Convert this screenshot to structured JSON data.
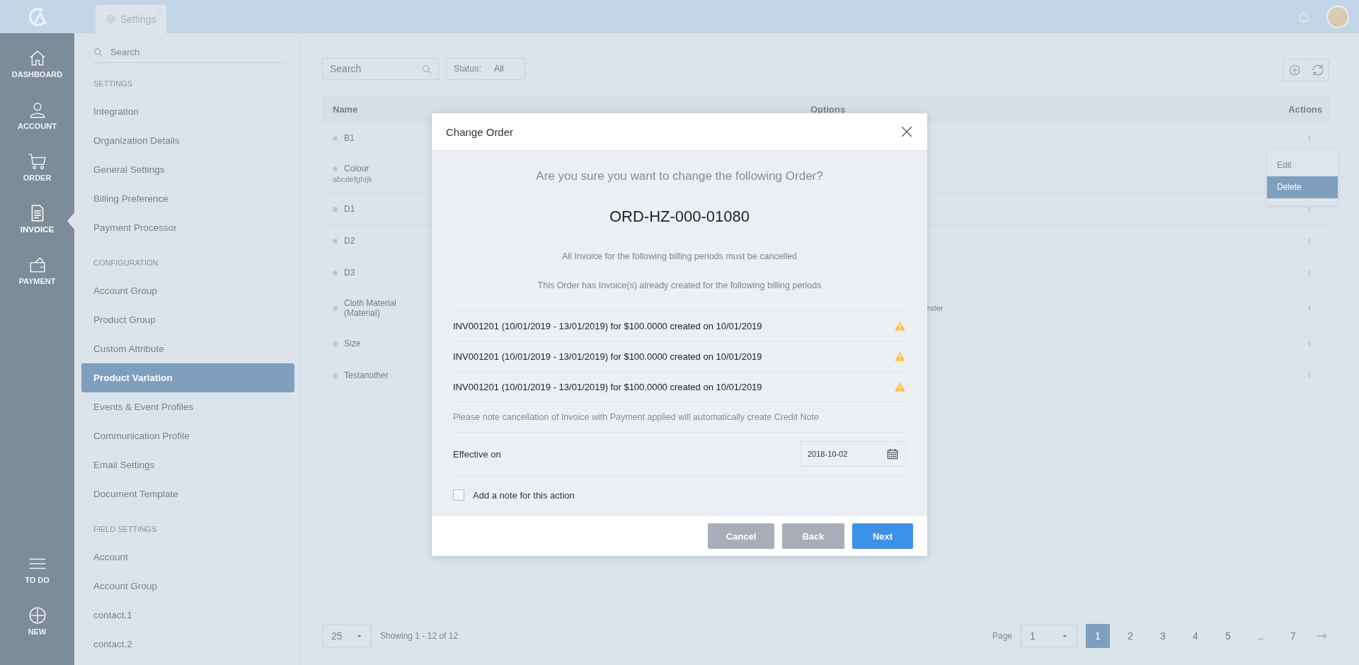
{
  "top_bar": {
    "tab": {
      "label": "Settings"
    }
  },
  "rail": {
    "items": [
      {
        "label": "DASHBOARD",
        "kind": "home",
        "selected": false
      },
      {
        "label": "ACCOUNT",
        "kind": "person",
        "selected": false
      },
      {
        "label": "ORDER",
        "kind": "cart",
        "selected": false
      },
      {
        "label": "INVOICE",
        "kind": "document",
        "selected": true
      },
      {
        "label": "PAYMENT",
        "kind": "wallet",
        "selected": false
      }
    ],
    "bottom_items": [
      {
        "label": "TO DO",
        "kind": "lines"
      },
      {
        "label": "NEW",
        "kind": "plus"
      }
    ]
  },
  "settings_nav": {
    "search": {
      "placeholder": "Search"
    },
    "sections": [
      {
        "heading": "SETTINGS",
        "items": [
          {
            "label": "Integration",
            "selected": false
          },
          {
            "label": "Organization Details",
            "selected": false
          },
          {
            "label": "General Settings",
            "selected": false
          },
          {
            "label": "Billing Preference",
            "selected": false
          },
          {
            "label": "Payment Processor",
            "selected": false
          }
        ]
      },
      {
        "heading": "CONFIGURATION",
        "items": [
          {
            "label": "Account Group",
            "selected": false
          },
          {
            "label": "Product Group",
            "selected": false
          },
          {
            "label": "Custom Attribute",
            "selected": false
          },
          {
            "label": "Product Variation",
            "selected": true
          },
          {
            "label": "Events & Event Profiles",
            "selected": false
          },
          {
            "label": "Communication Profile",
            "selected": false
          },
          {
            "label": "Email Settings",
            "selected": false
          },
          {
            "label": "Document Template",
            "selected": false
          }
        ]
      },
      {
        "heading": "FIELD SETTINGS",
        "items": [
          {
            "label": "Account",
            "selected": false
          },
          {
            "label": "Account Group",
            "selected": false
          },
          {
            "label": "contact.1",
            "selected": false
          },
          {
            "label": "contact.2",
            "selected": false
          }
        ]
      }
    ]
  },
  "toolbar": {
    "search": {
      "placeholder": "Search"
    },
    "status_filter": {
      "label": "Status:",
      "value": "All"
    }
  },
  "table": {
    "columns": [
      "Name",
      "Options",
      "Actions"
    ],
    "rows": [
      {
        "name": "B1",
        "actions": true
      },
      {
        "name": "Colour",
        "subtitle": "abcdefghijk",
        "actions": false
      },
      {
        "name": "D1",
        "actions": true
      },
      {
        "name": "D2",
        "actions": true
      },
      {
        "name": "D3",
        "actions": true
      },
      {
        "name": "Cloth Material (Material)",
        "options": "ester",
        "actions": true
      },
      {
        "name": "Size",
        "actions": true
      },
      {
        "name": "Testanother",
        "actions": true
      }
    ]
  },
  "row_menu": {
    "items": [
      {
        "label": "Edit",
        "selected": false
      },
      {
        "label": "Delete",
        "selected": true
      }
    ]
  },
  "pagination": {
    "page_size": "25",
    "summary": "Showing 1 - 12 of 12",
    "page_label": "Page",
    "page_select": "1",
    "pages": [
      {
        "label": "1",
        "selected": true
      },
      {
        "label": "2",
        "selected": false
      },
      {
        "label": "3",
        "selected": false
      },
      {
        "label": "4",
        "selected": false
      },
      {
        "label": "5",
        "selected": false
      },
      {
        "label": "..",
        "selected": false
      },
      {
        "label": "7",
        "selected": false
      }
    ]
  },
  "dialog": {
    "title": "Change Order",
    "question": "Are you sure you want to change the following Order?",
    "order_number": "ORD-HZ-000-01080",
    "notice": "All Invoice for the following billing periods must be cancelled",
    "subnotice": "This Order has Invoice(s) already created for the following billing periods",
    "invoices": [
      "INV001201 (10/01/2019 - 13/01/2019) for $100.0000 created on 10/01/2019",
      "INV001201 (10/01/2019 - 13/01/2019) for $100.0000 created on 10/01/2019",
      "INV001201 (10/01/2019 - 13/01/2019) for $100.0000 created on 10/01/2019"
    ],
    "footnote": "Please note cancellation of Invoice with Payment applied will automatically create Credit Note",
    "effective_on": {
      "label": "Effective on",
      "value": "2018-10-02"
    },
    "note_checkbox": {
      "label": "Add a note for this action",
      "checked": false
    },
    "buttons": [
      {
        "label": "Cancel",
        "kind": "secondary"
      },
      {
        "label": "Back",
        "kind": "secondary"
      },
      {
        "label": "Next",
        "kind": "primary"
      }
    ]
  }
}
